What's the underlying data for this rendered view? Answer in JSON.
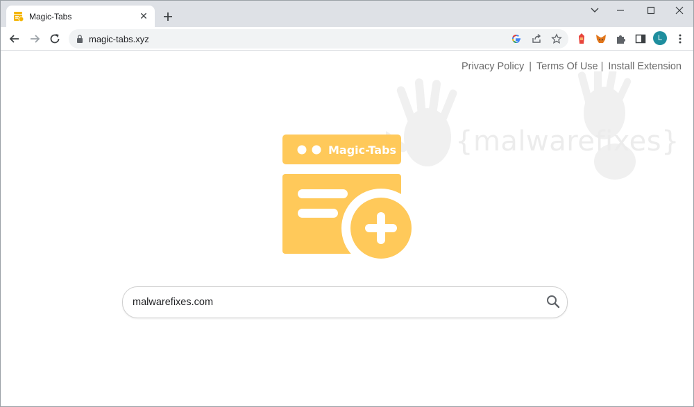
{
  "tab": {
    "title": "Magic-Tabs"
  },
  "address_bar": {
    "url": "magic-tabs.xyz"
  },
  "profile": {
    "initial": "L",
    "color": "#1e8e9e"
  },
  "header_links": [
    {
      "label": "Privacy Policy"
    },
    {
      "label": "Terms Of Use"
    },
    {
      "label": "Install Extension"
    }
  ],
  "separator": "|",
  "logo": {
    "text": "Magic-Tabs",
    "color": "#ffc95a"
  },
  "watermark": {
    "text": "{malwarefixes}"
  },
  "search": {
    "value": "malwarefixes.com"
  },
  "icons": {
    "tab_favicon": "magic-tabs-favicon-icon",
    "tab_close": "close-icon",
    "new_tab": "plus-icon",
    "back": "arrow-left-icon",
    "forward": "arrow-right-icon",
    "reload": "reload-icon",
    "lock": "lock-icon",
    "google": "google-icon",
    "share": "share-icon",
    "bookmark": "star-icon",
    "search": "magnifier-icon"
  }
}
